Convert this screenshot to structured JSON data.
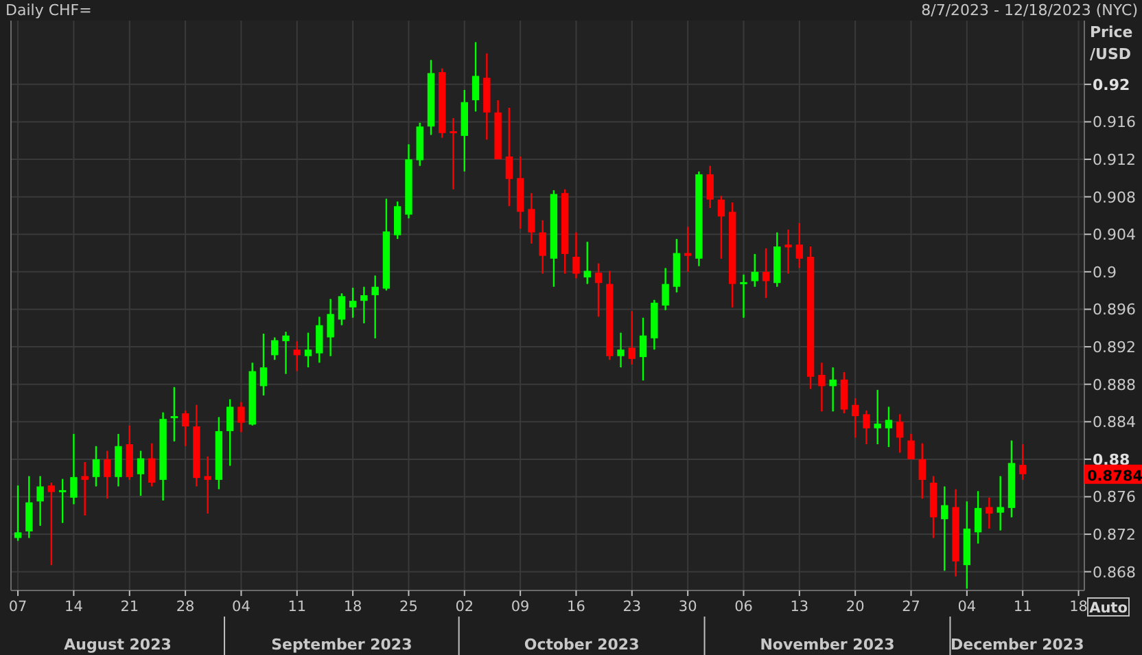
{
  "header": {
    "range": "8/7/2023 - 12/18/2023 (NYC)"
  },
  "chart": {
    "chart_data": {
      "type": "candlestick",
      "title": "Daily CHF=",
      "ylabel": "Price /USD",
      "categories": [
        "07",
        null,
        null,
        null,
        null,
        "14",
        null,
        null,
        null,
        null,
        "21",
        null,
        null,
        null,
        null,
        "28",
        null,
        null,
        null,
        null,
        "04",
        null,
        null,
        null,
        null,
        "11",
        null,
        null,
        null,
        null,
        "18",
        null,
        null,
        null,
        null,
        "25",
        null,
        null,
        null,
        null,
        "02",
        null,
        null,
        null,
        null,
        "09",
        null,
        null,
        null,
        null,
        "16",
        null,
        null,
        null,
        null,
        "23",
        null,
        null,
        null,
        null,
        "30",
        null,
        null,
        null,
        null,
        "06",
        null,
        null,
        null,
        null,
        "13",
        null,
        null,
        null,
        null,
        "20",
        null,
        null,
        null,
        null,
        "27",
        null,
        null,
        null,
        null,
        "04",
        null,
        null,
        null,
        null,
        "11",
        null,
        null,
        null,
        null,
        "18"
      ],
      "ylim": [
        0.866,
        0.9268
      ],
      "grid": true,
      "yticks": [
        {
          "value": 0.92,
          "label": "0.92"
        },
        {
          "value": 0.916,
          "label": "0.916"
        },
        {
          "value": 0.912,
          "label": "0.912"
        },
        {
          "value": 0.908,
          "label": "0.908"
        },
        {
          "value": 0.904,
          "label": "0.904"
        },
        {
          "value": 0.9,
          "label": "0.9"
        },
        {
          "value": 0.896,
          "label": "0.896"
        },
        {
          "value": 0.892,
          "label": "0.892"
        },
        {
          "value": 0.888,
          "label": "0.888"
        },
        {
          "value": 0.884,
          "label": "0.884"
        },
        {
          "value": 0.88,
          "label": "0.88"
        },
        {
          "value": 0.876,
          "label": "0.876"
        },
        {
          "value": 0.872,
          "label": "0.872"
        },
        {
          "value": 0.868,
          "label": "0.868"
        }
      ],
      "ohlc": [
        [
          0.8716,
          0.8772,
          0.8713,
          0.8722
        ],
        [
          0.8723,
          0.8782,
          0.8716,
          0.8754
        ],
        [
          0.8755,
          0.8782,
          0.8729,
          0.8771
        ],
        [
          0.8772,
          0.8775,
          0.8687,
          0.8765
        ],
        [
          0.8766,
          0.8779,
          0.8732,
          0.8767
        ],
        [
          0.8759,
          0.8827,
          0.8752,
          0.8781
        ],
        [
          0.8782,
          0.8797,
          0.874,
          0.8778
        ],
        [
          0.8781,
          0.8814,
          0.8771,
          0.88
        ],
        [
          0.88,
          0.8809,
          0.8758,
          0.8781
        ],
        [
          0.8781,
          0.8827,
          0.8771,
          0.8814
        ],
        [
          0.8816,
          0.8836,
          0.8778,
          0.8781
        ],
        [
          0.8784,
          0.8809,
          0.8761,
          0.8801
        ],
        [
          0.8801,
          0.8817,
          0.8771,
          0.8775
        ],
        [
          0.8778,
          0.885,
          0.8756,
          0.8843
        ],
        [
          0.8844,
          0.8877,
          0.8819,
          0.8846
        ],
        [
          0.8849,
          0.8852,
          0.8814,
          0.8835
        ],
        [
          0.8835,
          0.8858,
          0.8771,
          0.878
        ],
        [
          0.8782,
          0.8803,
          0.8742,
          0.8778
        ],
        [
          0.8778,
          0.8845,
          0.8768,
          0.883
        ],
        [
          0.883,
          0.8864,
          0.8793,
          0.8856
        ],
        [
          0.8856,
          0.8861,
          0.8829,
          0.8839
        ],
        [
          0.8837,
          0.8903,
          0.8836,
          0.8894
        ],
        [
          0.8878,
          0.8934,
          0.8868,
          0.8898
        ],
        [
          0.8911,
          0.893,
          0.8906,
          0.8927
        ],
        [
          0.8926,
          0.8936,
          0.8891,
          0.8932
        ],
        [
          0.8917,
          0.8926,
          0.8894,
          0.8911
        ],
        [
          0.891,
          0.8935,
          0.8898,
          0.8917
        ],
        [
          0.8913,
          0.8952,
          0.8903,
          0.8943
        ],
        [
          0.893,
          0.8971,
          0.891,
          0.8955
        ],
        [
          0.8949,
          0.8977,
          0.8943,
          0.8974
        ],
        [
          0.8962,
          0.8983,
          0.8951,
          0.8969
        ],
        [
          0.8969,
          0.8984,
          0.8945,
          0.8975
        ],
        [
          0.8975,
          0.8996,
          0.8929,
          0.8984
        ],
        [
          0.8982,
          0.9078,
          0.898,
          0.9043
        ],
        [
          0.9039,
          0.9075,
          0.9035,
          0.907
        ],
        [
          0.9061,
          0.9136,
          0.9057,
          0.912
        ],
        [
          0.9119,
          0.9159,
          0.9113,
          0.9155
        ],
        [
          0.9155,
          0.9226,
          0.9146,
          0.9212
        ],
        [
          0.9213,
          0.9217,
          0.9143,
          0.9148
        ],
        [
          0.915,
          0.9164,
          0.9088,
          0.9149
        ],
        [
          0.9145,
          0.9194,
          0.9107,
          0.9181
        ],
        [
          0.9183,
          0.9245,
          0.9171,
          0.9209
        ],
        [
          0.9207,
          0.9233,
          0.9141,
          0.917
        ],
        [
          0.917,
          0.9183,
          0.912,
          0.912
        ],
        [
          0.9123,
          0.9175,
          0.907,
          0.9099
        ],
        [
          0.91,
          0.9123,
          0.9046,
          0.9064
        ],
        [
          0.9067,
          0.9084,
          0.903,
          0.9042
        ],
        [
          0.9042,
          0.9055,
          0.8998,
          0.9017
        ],
        [
          0.9014,
          0.9087,
          0.8984,
          0.9083
        ],
        [
          0.9084,
          0.9088,
          0.8998,
          0.9019
        ],
        [
          0.9016,
          0.9042,
          0.8993,
          0.8998
        ],
        [
          0.8994,
          0.9032,
          0.8987,
          0.9001
        ],
        [
          0.8999,
          0.9009,
          0.8952,
          0.8988
        ],
        [
          0.8987,
          0.9001,
          0.8906,
          0.891
        ],
        [
          0.891,
          0.8935,
          0.8898,
          0.8917
        ],
        [
          0.8919,
          0.8958,
          0.8901,
          0.8907
        ],
        [
          0.8909,
          0.8951,
          0.8884,
          0.8932
        ],
        [
          0.8929,
          0.897,
          0.8917,
          0.8967
        ],
        [
          0.8964,
          0.9004,
          0.8959,
          0.8987
        ],
        [
          0.8984,
          0.9035,
          0.8978,
          0.902
        ],
        [
          0.902,
          0.9048,
          0.9,
          0.9017
        ],
        [
          0.9014,
          0.9107,
          0.9006,
          0.9104
        ],
        [
          0.9104,
          0.9113,
          0.9068,
          0.9077
        ],
        [
          0.9077,
          0.9081,
          0.9014,
          0.9059
        ],
        [
          0.9064,
          0.9074,
          0.8962,
          0.8987
        ],
        [
          0.8987,
          0.8997,
          0.8951,
          0.8989
        ],
        [
          0.899,
          0.9019,
          0.8984,
          0.9
        ],
        [
          0.9,
          0.9025,
          0.8972,
          0.899
        ],
        [
          0.8988,
          0.9042,
          0.8984,
          0.9027
        ],
        [
          0.9029,
          0.9045,
          0.8998,
          0.9026
        ],
        [
          0.9029,
          0.9052,
          0.9004,
          0.9014
        ],
        [
          0.9016,
          0.9027,
          0.8875,
          0.8888
        ],
        [
          0.889,
          0.8903,
          0.8851,
          0.8878
        ],
        [
          0.8878,
          0.8898,
          0.8851,
          0.8885
        ],
        [
          0.8885,
          0.8893,
          0.8849,
          0.8853
        ],
        [
          0.8858,
          0.8865,
          0.8823,
          0.8846
        ],
        [
          0.8848,
          0.8852,
          0.8816,
          0.8833
        ],
        [
          0.8833,
          0.8874,
          0.8816,
          0.8838
        ],
        [
          0.8833,
          0.8856,
          0.8813,
          0.8842
        ],
        [
          0.884,
          0.8848,
          0.8807,
          0.8823
        ],
        [
          0.882,
          0.8827,
          0.88,
          0.88
        ],
        [
          0.88,
          0.8817,
          0.8758,
          0.8778
        ],
        [
          0.8775,
          0.8782,
          0.8716,
          0.8738
        ],
        [
          0.8736,
          0.8771,
          0.8681,
          0.8751
        ],
        [
          0.8749,
          0.8768,
          0.8675,
          0.8691
        ],
        [
          0.8687,
          0.8755,
          0.8662,
          0.8726
        ],
        [
          0.8722,
          0.8766,
          0.871,
          0.8748
        ],
        [
          0.8749,
          0.8759,
          0.8726,
          0.8742
        ],
        [
          0.8743,
          0.8782,
          0.8724,
          0.8749
        ],
        [
          0.8748,
          0.882,
          0.8738,
          0.8796
        ],
        [
          0.8794,
          0.8816,
          0.8778,
          0.8784
        ],
        null,
        null,
        null,
        null,
        null
      ]
    },
    "last_price": "0.8784",
    "months": [
      "August 2023",
      "September 2023",
      "October 2023",
      "November 2023",
      "December 2023"
    ],
    "auto_button": "Auto"
  }
}
